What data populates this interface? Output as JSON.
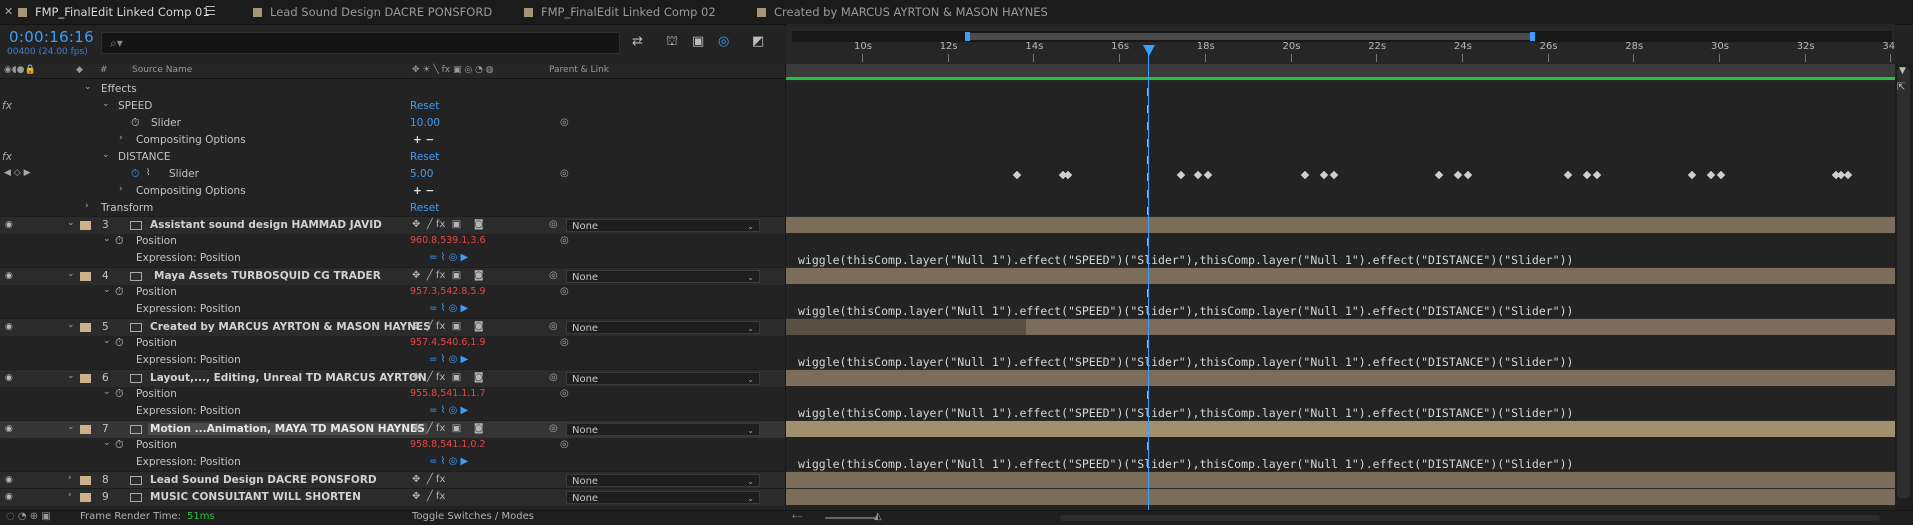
{
  "tabs": [
    {
      "label": "FMP_FinalEdit Linked Comp 01",
      "active": true
    },
    {
      "label": "Lead Sound Design DACRE PONSFORD",
      "active": false
    },
    {
      "label": "FMP_FinalEdit Linked Comp 02",
      "active": false
    },
    {
      "label": "Created by MARCUS AYRTON & MASON HAYNES",
      "active": false
    }
  ],
  "timecode": "0:00:16:16",
  "frame_info": "00400 (24.00 fps)",
  "search": {
    "placeholder": "",
    "icon": "search-icon"
  },
  "columns": {
    "source_name": "Source Name",
    "parent_link": "Parent & Link",
    "hash": "#"
  },
  "effects": {
    "effects_label": "Effects",
    "speed": {
      "name": "SPEED",
      "reset": "Reset",
      "slider_label": "Slider",
      "slider_value": "10.00",
      "compositing": "Compositing Options"
    },
    "distance": {
      "name": "DISTANCE",
      "reset": "Reset",
      "slider_label": "Slider",
      "slider_value": "5.00",
      "compositing": "Compositing Options"
    },
    "transform_label": "Transform",
    "transform_reset": "Reset",
    "plus_minus": "+ −"
  },
  "layers": [
    {
      "num": "3",
      "name": "Assistant sound design HAMMAD JAVID",
      "parent": "None",
      "position": "960.8,539.1,3.6"
    },
    {
      "num": "4",
      "name": "Maya Assets TURBOSQUID CG TRADER",
      "parent": "None",
      "position": "957.3,542.8,5.9"
    },
    {
      "num": "5",
      "name": "Created by MARCUS AYRTON & MASON HAYNES",
      "parent": "None",
      "position": "957.4,540.6,1.9"
    },
    {
      "num": "6",
      "name": "Layout,..., Editing, Unreal TD MARCUS AYRTON",
      "parent": "None",
      "position": "955.8,541.1,1.7"
    },
    {
      "num": "7",
      "name": "Motion ...Animation, MAYA TD MASON HAYNES",
      "parent": "None",
      "position": "958.8,541.1,0.2"
    },
    {
      "num": "8",
      "name": "Lead Sound Design DACRE PONSFORD",
      "parent": "None"
    },
    {
      "num": "9",
      "name": "MUSIC CONSULTANT WILL SHORTEN",
      "parent": "None"
    }
  ],
  "labels": {
    "position": "Position",
    "expression": "Expression: Position"
  },
  "expression_text": "wiggle(thisComp.layer(\"Null 1\").effect(\"SPEED\")(\"Slider\"),thisComp.layer(\"Null 1\").effect(\"DISTANCE\")(\"Slider\"))",
  "ruler_ticks": [
    "10s",
    "12s",
    "14s",
    "16s",
    "18s",
    "20s",
    "22s",
    "24s",
    "26s",
    "28s",
    "30s",
    "32s",
    "34"
  ],
  "bottom": {
    "render_label": "Frame Render Time:",
    "render_value": "51ms",
    "toggle": "Toggle Switches / Modes"
  },
  "colors": {
    "accent": "#3d9dfb",
    "label": "#c9b28c",
    "layer_bar": "#7b6d59",
    "work_area": "#23c23a",
    "value_red": "#e84646"
  }
}
